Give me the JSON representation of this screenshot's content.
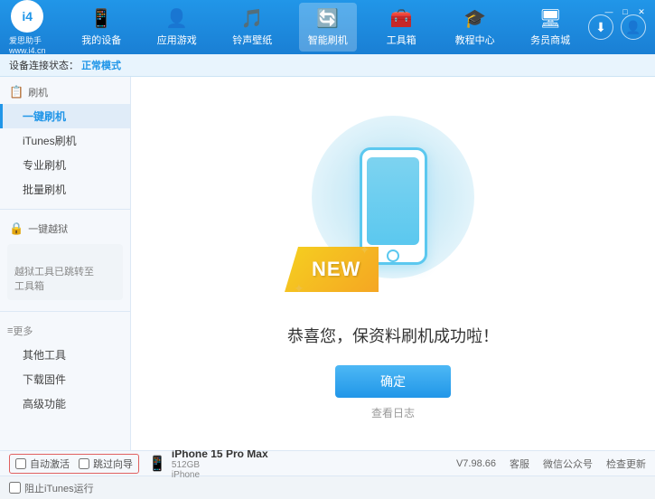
{
  "app": {
    "logo_text": "爱思助手",
    "logo_sub": "www.i4.cn",
    "logo_char": "i4"
  },
  "nav": {
    "items": [
      {
        "id": "my-device",
        "icon": "📱",
        "label": "我的设备"
      },
      {
        "id": "apps-games",
        "icon": "👤",
        "label": "应用游戏"
      },
      {
        "id": "ringtones",
        "icon": "🎵",
        "label": "铃声壁纸"
      },
      {
        "id": "smart-flash",
        "icon": "🔄",
        "label": "智能刷机",
        "active": true
      },
      {
        "id": "toolbox",
        "icon": "🧰",
        "label": "工具箱"
      },
      {
        "id": "tutorial",
        "icon": "🎓",
        "label": "教程中心"
      },
      {
        "id": "business",
        "icon": "🖥",
        "label": "务员商城"
      }
    ]
  },
  "window_controls": {
    "minimize": "—",
    "maximize": "□",
    "close": "✕"
  },
  "status_bar": {
    "prefix": "设备连接状态：",
    "status": "正常模式"
  },
  "sidebar": {
    "flash_header": "刷机",
    "items": [
      {
        "id": "one-key-flash",
        "label": "一键刷机",
        "active": true
      },
      {
        "id": "itunes-flash",
        "label": "iTunes刷机"
      },
      {
        "id": "pro-flash",
        "label": "专业刷机"
      },
      {
        "id": "batch-flash",
        "label": "批量刷机"
      }
    ],
    "jailbreak_header": "一键越狱",
    "jailbreak_notice": "越狱工具已跳转至\n工具箱",
    "more_header": "更多",
    "more_items": [
      {
        "id": "other-tools",
        "label": "其他工具"
      },
      {
        "id": "download-firmware",
        "label": "下载固件"
      },
      {
        "id": "advanced",
        "label": "高级功能"
      }
    ]
  },
  "content": {
    "ribbon_text": "NEW",
    "success_text": "恭喜您，保资料刷机成功啦！",
    "confirm_label": "确定",
    "log_label": "查看日志"
  },
  "device": {
    "auto_activate_label": "自动激活",
    "guide_label": "跳过向导",
    "name": "iPhone 15 Pro Max",
    "storage": "512GB",
    "type": "iPhone",
    "icon": "📱"
  },
  "footer": {
    "itunes_label": "阻止iTunes运行",
    "version": "V7.98.66",
    "home_label": "客服",
    "wechat_label": "微信公众号",
    "check_update_label": "检查更新"
  }
}
